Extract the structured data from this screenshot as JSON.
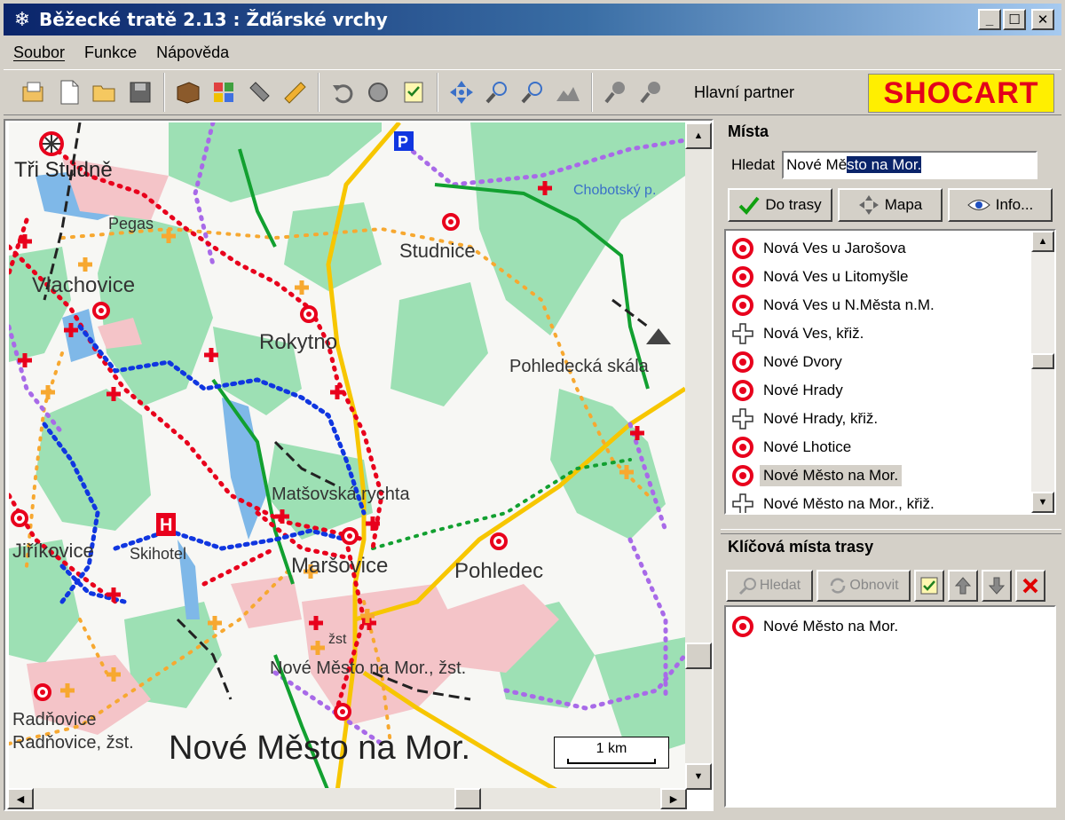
{
  "window": {
    "title": "Běžecké tratě 2.13 : Žďárské vrchy",
    "minimize": "_",
    "maximize": "☐",
    "close": "✕"
  },
  "menu": {
    "soubor": "Soubor",
    "funkce": "Funkce",
    "napoveda": "Nápověda"
  },
  "toolbar": {
    "partner_label": "Hlavní partner",
    "partner_logo": "SHOCART"
  },
  "map": {
    "labels": {
      "tri_studne": "Tři Studně",
      "pegas": "Pegas",
      "vlachovice": "Vlachovice",
      "studnice": "Studnice",
      "rokytno": "Rokytno",
      "pohledecka_skala": "Pohledecká skála",
      "matsovska_rychta": "Matšovská rychta",
      "jirikovice": "Jiříkovice",
      "skihotel": "Skihotel",
      "marsovice": "Maršovice",
      "pohledec": "Pohledec",
      "nove_mesto_zst": "Nové Město na Mor., žst.",
      "radnovice": "Radňovice",
      "radnovice_zst": "Radňovice, žst.",
      "nove_mesto_big": "Nové Město na Mor.",
      "chobotsky": "Chobotský p.",
      "zst": "žst"
    },
    "scale_label": "1 km",
    "colors": {
      "forest": "#9de0b4",
      "water": "#7fb8e8",
      "urban": "#f4c4c8",
      "road_yellow": "#f7c600",
      "trail_red": "#e8001c",
      "trail_blue": "#1036e0",
      "trail_green": "#12a030",
      "trail_purple": "#a86ae8",
      "trail_orange": "#f7a830"
    }
  },
  "places_panel": {
    "title": "Místa",
    "search_label": "Hledat",
    "search_value_plain": "Nové Mě",
    "search_value_selected": "sto na Mor.",
    "btn_do_trasy": "Do trasy",
    "btn_mapa": "Mapa",
    "btn_info": "Info...",
    "items": [
      {
        "label": "Nová Ves u Jarošova",
        "icon": "place-target"
      },
      {
        "label": "Nová Ves u Litomyšle",
        "icon": "place-target"
      },
      {
        "label": "Nová Ves u N.Města n.M.",
        "icon": "place-target"
      },
      {
        "label": "Nová Ves, křiž.",
        "icon": "crossroad"
      },
      {
        "label": "Nové Dvory",
        "icon": "place-target"
      },
      {
        "label": "Nové Hrady",
        "icon": "place-target"
      },
      {
        "label": "Nové Hrady, křiž.",
        "icon": "crossroad"
      },
      {
        "label": "Nové Lhotice",
        "icon": "place-target"
      },
      {
        "label": "Nové Město na Mor.",
        "icon": "place-target",
        "selected": true
      },
      {
        "label": "Nové Město na Mor., křiž.",
        "icon": "crossroad"
      }
    ]
  },
  "route_panel": {
    "title": "Klíčová místa trasy",
    "btn_hledat": "Hledat",
    "btn_obnovit": "Obnovit",
    "items": [
      {
        "label": "Nové Město na Mor.",
        "icon": "place-target"
      }
    ]
  }
}
